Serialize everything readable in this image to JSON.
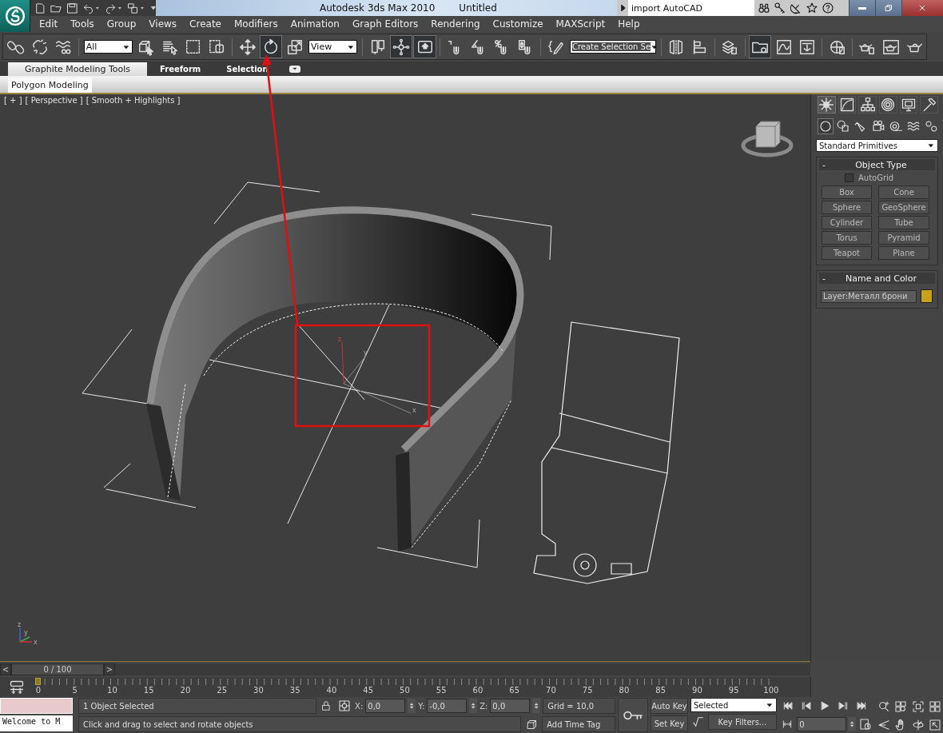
{
  "title_bar": {
    "title": "Autodesk 3ds Max  2010",
    "document": "Untitled",
    "search": {
      "value": "import AutoCAD"
    }
  },
  "menu_bar": {
    "items": [
      {
        "label": "Edit"
      },
      {
        "label": "Tools"
      },
      {
        "label": "Group"
      },
      {
        "label": "Views"
      },
      {
        "label": "Create"
      },
      {
        "label": "Modifiers"
      },
      {
        "label": "Animation"
      },
      {
        "label": "Graph Editors"
      },
      {
        "label": "Rendering"
      },
      {
        "label": "Customize"
      },
      {
        "label": "MAXScript"
      },
      {
        "label": "Help"
      }
    ]
  },
  "main_toolbar": {
    "items": [
      {
        "kind": "button",
        "selected": false
      },
      {
        "kind": "button",
        "selected": false
      },
      {
        "kind": "button",
        "selected": false
      },
      {
        "kind": "dropdown",
        "value": "All"
      },
      {
        "kind": "button",
        "selected": false
      },
      {
        "kind": "button",
        "selected": false
      },
      {
        "kind": "button",
        "selected": false
      },
      {
        "kind": "button",
        "selected": false
      },
      {
        "kind": "button",
        "selected": false
      },
      {
        "kind": "button",
        "selected": true
      },
      {
        "kind": "button",
        "selected": false
      },
      {
        "kind": "dropdown",
        "value": "View"
      },
      {
        "kind": "button",
        "selected": false
      },
      {
        "kind": "button",
        "selected": true
      },
      {
        "kind": "button",
        "selected": true
      },
      {
        "kind": "button",
        "selected": false
      },
      {
        "kind": "button",
        "selected": false
      },
      {
        "kind": "button",
        "selected": false
      },
      {
        "kind": "button",
        "selected": false
      },
      {
        "kind": "button",
        "selected": false
      },
      {
        "kind": "dropdown",
        "value": "Create Selection Se"
      },
      {
        "kind": "button",
        "selected": false
      },
      {
        "kind": "button",
        "selected": false
      },
      {
        "kind": "button",
        "selected": false
      },
      {
        "kind": "button",
        "selected": true
      },
      {
        "kind": "button",
        "selected": false
      },
      {
        "kind": "button",
        "selected": false
      },
      {
        "kind": "button",
        "selected": false
      },
      {
        "kind": "button",
        "selected": false
      },
      {
        "kind": "button",
        "selected": false
      },
      {
        "kind": "button",
        "selected": false
      }
    ]
  },
  "ribbon": {
    "tabs": [
      {
        "label": "Graphite Modeling Tools",
        "selected": true
      },
      {
        "label": "Freeform",
        "selected": false
      },
      {
        "label": "Selection",
        "selected": false
      }
    ],
    "panels": [
      {
        "label": "Polygon Modeling",
        "selected": true
      }
    ]
  },
  "viewport": {
    "labels": [
      "[ + ]",
      "[ Perspective ]",
      "[ Smooth + Highlights ]"
    ],
    "gizmo_axes": [
      "z",
      "y",
      "x"
    ],
    "corner_axes": [
      "z",
      "y",
      "x"
    ]
  },
  "command_panel": {
    "tabs": [
      {
        "selected": true
      },
      {
        "selected": false
      },
      {
        "selected": false
      },
      {
        "selected": false
      },
      {
        "selected": false
      },
      {
        "selected": false
      }
    ],
    "categories": [
      {
        "selected": true
      },
      {
        "selected": false
      },
      {
        "selected": false
      },
      {
        "selected": false
      },
      {
        "selected": false
      },
      {
        "selected": false
      },
      {
        "selected": false
      }
    ],
    "dropdown": {
      "value": "Standard Primitives"
    },
    "rollouts": [
      {
        "kind": "object_type",
        "toggle": "-",
        "title": "Object Type",
        "expanded": true,
        "autogrid": {
          "label": "AutoGrid",
          "checked": false
        },
        "buttons": [
          "Box",
          "Cone",
          "Sphere",
          "GeoSphere",
          "Cylinder",
          "Tube",
          "Torus",
          "Pyramid",
          "Teapot",
          "Plane"
        ]
      },
      {
        "kind": "name_color",
        "toggle": "-",
        "title": "Name and Color",
        "expanded": true,
        "name": "Layer:Металл брони",
        "color": "#c9a21c"
      }
    ]
  },
  "time_slider": {
    "prev": "<",
    "position": "0 / 100",
    "next": ">"
  },
  "track_bar": {
    "labels": [
      "0",
      "5",
      "10",
      "15",
      "20",
      "25",
      "30",
      "35",
      "40",
      "45",
      "50",
      "55",
      "60",
      "65",
      "70",
      "75",
      "80",
      "85",
      "90",
      "95",
      "100"
    ]
  },
  "status_bar": {
    "listener": "Welcome to M",
    "selection": "1 Object Selected",
    "prompt": "Click and drag to select and rotate objects",
    "coords": [
      {
        "label": "X:",
        "value": "0,0"
      },
      {
        "label": "Y:",
        "value": "-0,0"
      },
      {
        "label": "Z:",
        "value": "0,0"
      }
    ],
    "grid": "Grid = 10,0",
    "time_tag": "Add Time Tag",
    "auto_key": "Auto Key",
    "set_key": "Set Key",
    "key_mode": "Selected",
    "key_filters": "Key Filters...",
    "frame": "0"
  }
}
